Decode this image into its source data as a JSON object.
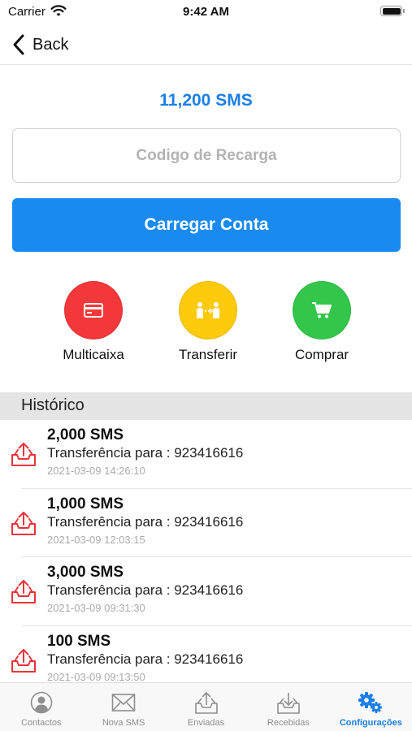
{
  "status_bar": {
    "carrier": "Carrier",
    "time": "9:42 AM"
  },
  "nav": {
    "back_label": "Back"
  },
  "balance": "11,200  SMS",
  "recharge": {
    "placeholder": "Codigo de Recarga",
    "value": ""
  },
  "load_button_label": "Carregar Conta",
  "actions": [
    {
      "label": "Multicaixa",
      "color": "#f2383a",
      "icon": "card-icon"
    },
    {
      "label": "Transferir",
      "color": "#fdca0c",
      "icon": "transfer-people-icon"
    },
    {
      "label": "Comprar",
      "color": "#33c64a",
      "icon": "cart-icon"
    }
  ],
  "history": {
    "title": "Histórico",
    "items": [
      {
        "amount": "2,000  SMS",
        "description": "Transferência para : 923416616",
        "date": "2021-03-09 14:26:10"
      },
      {
        "amount": "1,000  SMS",
        "description": "Transferência para : 923416616",
        "date": "2021-03-09 12:03:15"
      },
      {
        "amount": "3,000  SMS",
        "description": "Transferência para : 923416616",
        "date": "2021-03-09 09:31:30"
      },
      {
        "amount": "100  SMS",
        "description": "Transferência para : 923416616",
        "date": "2021-03-09 09:13:50"
      }
    ]
  },
  "tabs": [
    {
      "label": "Contactos",
      "icon": "contacts-icon",
      "active": false
    },
    {
      "label": "Nova SMS",
      "icon": "envelope-icon",
      "active": false
    },
    {
      "label": "Enviadas",
      "icon": "outbox-icon",
      "active": false
    },
    {
      "label": "Recebidas",
      "icon": "inbox-icon",
      "active": false
    },
    {
      "label": "Configurações",
      "icon": "gears-icon",
      "active": true
    }
  ],
  "colors": {
    "accent": "#1a7fe6",
    "button": "#1a8af0",
    "history_icon": "#e8343a",
    "tab_inactive": "#8e8e8e"
  }
}
